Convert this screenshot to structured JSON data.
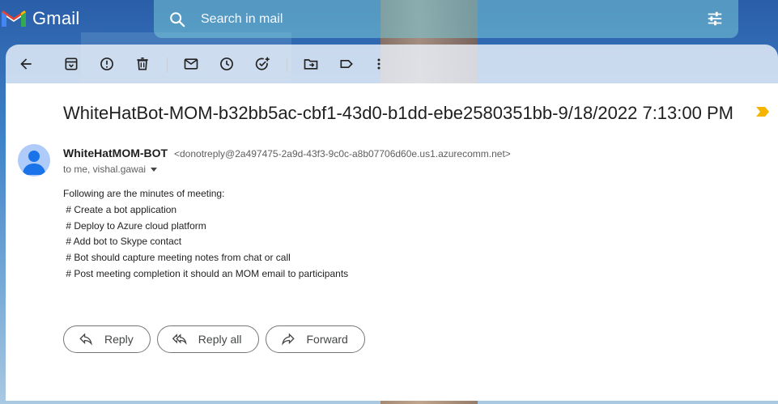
{
  "app": {
    "logo_text": "Gmail"
  },
  "search": {
    "placeholder": "Search in mail",
    "value": ""
  },
  "toolbar": {
    "icons": [
      "back-arrow-icon",
      "archive-icon",
      "report-spam-icon",
      "delete-icon",
      "mark-unread-icon",
      "snooze-icon",
      "add-task-icon",
      "move-to-icon",
      "label-icon",
      "more-icon"
    ]
  },
  "message": {
    "subject": "WhiteHatBot-MOM-b32bb5ac-cbf1-43d0-b1dd-ebe2580351bb-9/18/2022 7:13:00 PM",
    "sender_name": "WhiteHatMOM-BOT",
    "sender_email": "<donotreply@2a497475-2a9d-43f3-9c0c-a8b07706d60e.us1.azurecomm.net>",
    "recipients": "to me, vishal.gawai",
    "body_lines": [
      "Following are the minutes of meeting:",
      " # Create a bot application",
      " # Deploy to Azure cloud platform",
      " # Add bot to Skype contact",
      " # Bot should capture meeting notes from chat or call",
      " # Post meeting completion it should an MOM email to participants"
    ]
  },
  "actions": {
    "reply": "Reply",
    "reply_all": "Reply all",
    "forward": "Forward"
  },
  "colors": {
    "important_marker": "#f4b400",
    "avatar": "#aecbfa",
    "avatar_figure": "#1a73e8"
  }
}
